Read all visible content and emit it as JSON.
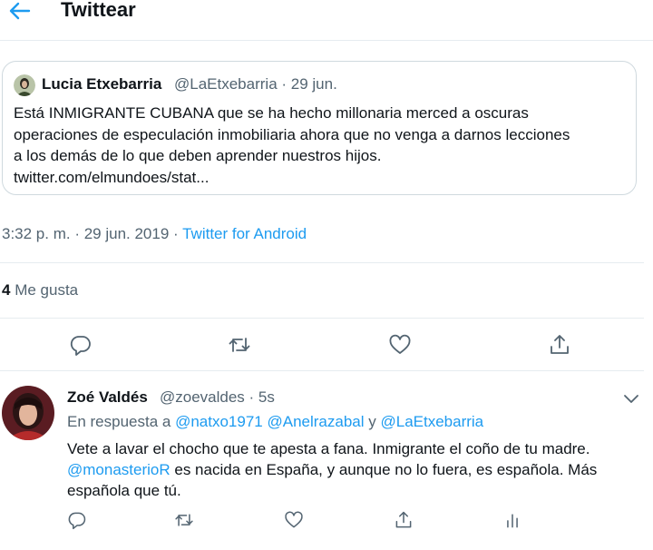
{
  "header": {
    "title": "Twittear"
  },
  "quoted_tweet": {
    "author_name": "Lucia Etxebarria",
    "handle_and_date": "@LaEtxebarria · 29 jun.",
    "text_line_1": "Está INMIGRANTE CUBANA que se ha hecho millonaria  merced a oscuras",
    "text_line_2": "operaciones de especulación inmobiliaria ahora que no venga a darnos lecciones",
    "text_line_3": "a los demás de lo que deben aprender nuestros hijos.",
    "text_line_4": "twitter.com/elmundoes/stat..."
  },
  "meta": {
    "time_date": "3:32 p. m. · 29 jun. 2019 · ",
    "source": "Twitter for Android"
  },
  "likes": {
    "count": "4",
    "label": " Me gusta"
  },
  "actions": {
    "reply": "reply-icon",
    "retweet": "retweet-icon",
    "like": "heart-icon",
    "share": "share-icon"
  },
  "reply_tweet": {
    "author_name": "Zoé Valdés",
    "handle_and_time": "@zoevaldes · 5s",
    "reply_prefix": "En respuesta a ",
    "mention_1": "@natxo1971",
    "mention_2": "@Anelrazabal",
    "conjunction": " y ",
    "mention_3": "@LaEtxebarria",
    "text_line_1": "Vete a lavar el chocho que te apesta a fana. Inmigrante el coño de tu madre.",
    "text_line_2_mention": "@monasterioR",
    "text_line_2_rest": " es nacida en España, y aunque no lo fuera, es española. Más",
    "text_line_3": "española que tú."
  },
  "colors": {
    "accent": "#1d9bf0",
    "text": "#0f1419",
    "secondary": "#536471",
    "border": "#e6ecf0"
  }
}
